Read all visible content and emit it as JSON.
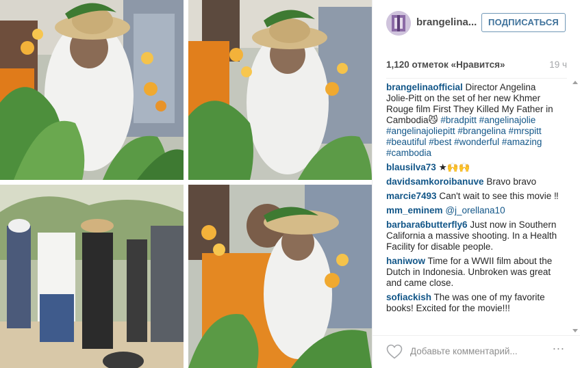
{
  "post": {
    "username": "brangelina...",
    "follow_label": "ПОДПИСАТЬСЯ",
    "likes": "1,120 отметок «Нравится»",
    "time_ago": "19 ч",
    "comment_placeholder": "Добавьте комментарий...",
    "more_label": "∙∙∙"
  },
  "caption": {
    "user": "brangelinaofficial",
    "text": "Director Angelina Jolie-Pitt on the set of her new Khmer Rouge film First They Killed My Father in Cambodia😼",
    "hashtags": "#bradpitt #angelinajolie #angelinajoliepitt #brangelina #mrspitt #beautiful #best #wonderful #amazing #cambodia"
  },
  "comments": [
    {
      "user": "blausilva73",
      "text": "★🙌🙌"
    },
    {
      "user": "davidsamkoroibanuve",
      "text": "Bravo bravo"
    },
    {
      "user": "marcie7493",
      "text": "Can't wait to see this movie ‼"
    },
    {
      "user": "mm_eminem",
      "text": "@j_orellana10",
      "mention": true
    },
    {
      "user": "barbara6butterfly6",
      "text": "Just now in Southern California a massive shooting. In a Health Facility for disable people."
    },
    {
      "user": "haniwow",
      "text": "Time for a WWII film about the Dutch in Indonesia. Unbroken was great and came close."
    },
    {
      "user": "sofiackish",
      "text": "The was one of my favorite books! Excited for the movie!!!"
    }
  ],
  "colors": {
    "link": "#125688",
    "follow_border": "#6f97b6",
    "follow_text": "#3f729b",
    "muted": "#a5a7aa",
    "divider": "#efefef"
  },
  "icons": [
    "heart-icon",
    "more-options-icon",
    "scroll-up-icon",
    "scroll-down-icon"
  ]
}
